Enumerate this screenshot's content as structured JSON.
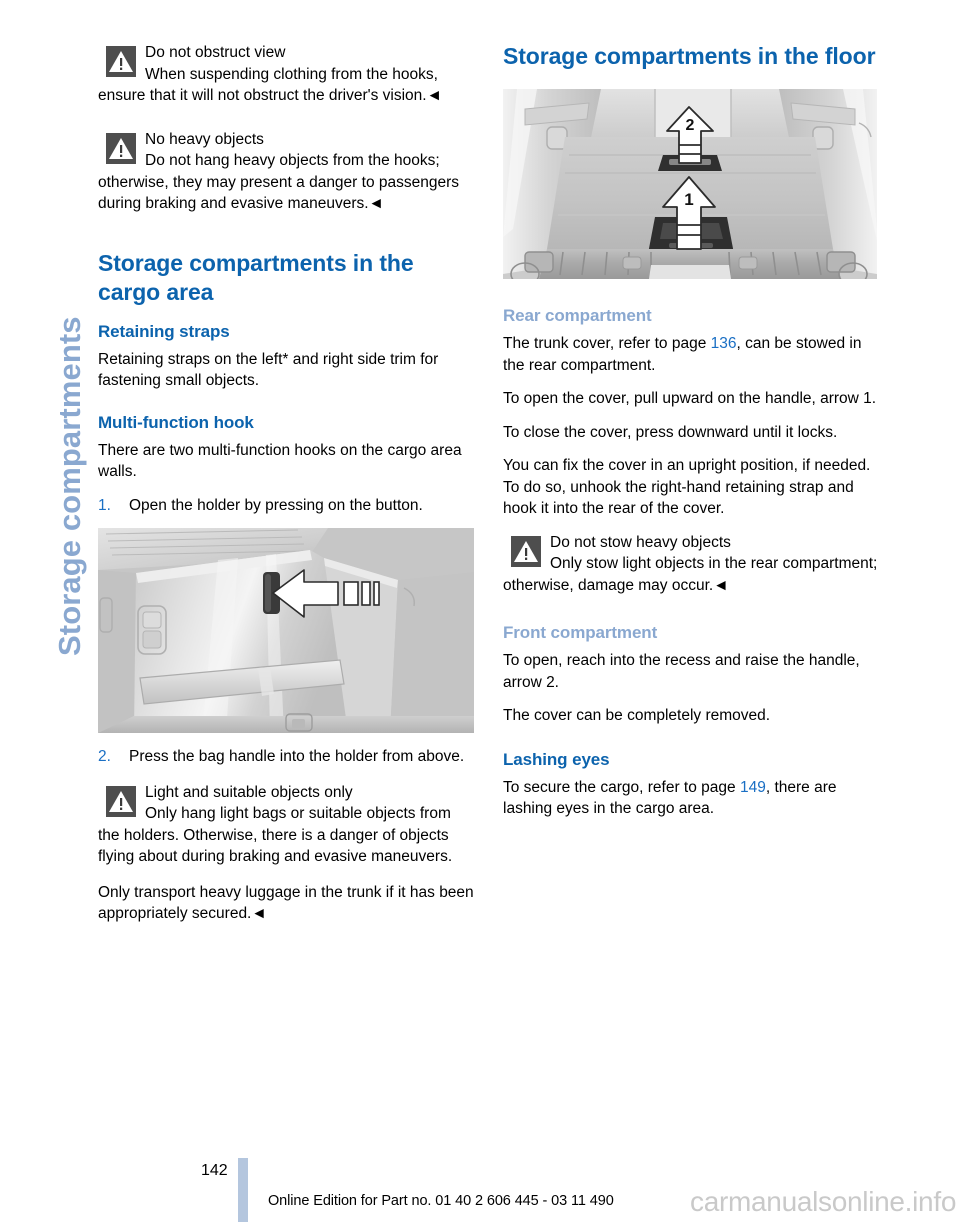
{
  "side_tab": {
    "label": "Storage compartments"
  },
  "colors": {
    "heading_blue": "#0c63ad",
    "muted_blue": "#8aa8d0",
    "link_blue": "#1a6fc4",
    "warning_box": "#4e4e4e",
    "footer_rule": "#b4c6de"
  },
  "left_column": {
    "warning_1": {
      "title": "Do not obstruct view",
      "text": "When suspending clothing from the hooks, ensure that it will not obstruct the driver's vision.◄"
    },
    "warning_2": {
      "title": "No heavy objects",
      "text": "Do not hang heavy objects from the hooks; otherwise, they may present a danger to passengers during braking and evasive maneuvers.◄"
    },
    "section_title": "Storage compartments in the cargo area",
    "retaining_straps": {
      "heading": "Retaining straps",
      "body": "Retaining straps on the left* and right side trim for fastening small objects."
    },
    "multi_function_hook": {
      "heading": "Multi-function hook",
      "body": "There are two multi-function hooks on the cargo area walls.",
      "step_1_num": "1.",
      "step_1": "Open the holder by pressing on the button.",
      "step_2_num": "2.",
      "step_2": "Press the bag handle into the holder from above."
    },
    "figure_hook": {
      "alt": "cargo-area-side-trim-multi-function-hook"
    },
    "warning_3": {
      "title": "Light and suitable objects only",
      "text": "Only hang light bags or suitable objects from the holders. Otherwise, there is a danger of objects flying about during braking and evasive maneuvers."
    },
    "closing_paragraph": "Only transport heavy luggage in the trunk if it has been appropriately secured.◄"
  },
  "right_column": {
    "section_title": "Storage compartments in the floor",
    "figure_floor": {
      "alt": "cargo-floor-storage-compartments",
      "arrow_labels": [
        "1",
        "2"
      ]
    },
    "rear_compartment": {
      "heading": "Rear compartment",
      "p1_before": "The trunk cover, refer to page ",
      "p1_page": "136",
      "p1_after": ", can be stowed in the rear compartment.",
      "p2": "To open the cover, pull upward on the handle, arrow 1.",
      "p3": "To close the cover, press downward until it locks.",
      "p4": "You can fix the cover in an upright position, if needed. To do so, unhook the right-hand retaining strap and hook it into the rear of the cover."
    },
    "warning_4": {
      "title": "Do not stow heavy objects",
      "text": "Only stow light objects in the rear compartment; otherwise, damage may occur.◄"
    },
    "front_compartment": {
      "heading": "Front compartment",
      "p1": "To open, reach into the recess and raise the handle, arrow 2.",
      "p2": "The cover can be completely removed."
    },
    "lashing_eyes": {
      "heading": "Lashing eyes",
      "p1_before": "To secure the cargo, refer to page ",
      "p1_page": "149",
      "p1_after": ", there are lashing eyes in the cargo area."
    }
  },
  "footer": {
    "page_number": "142",
    "edition_text": "Online Edition for Part no. 01 40 2 606 445 - 03 11 490",
    "watermark": "carmanualsonline.info"
  }
}
